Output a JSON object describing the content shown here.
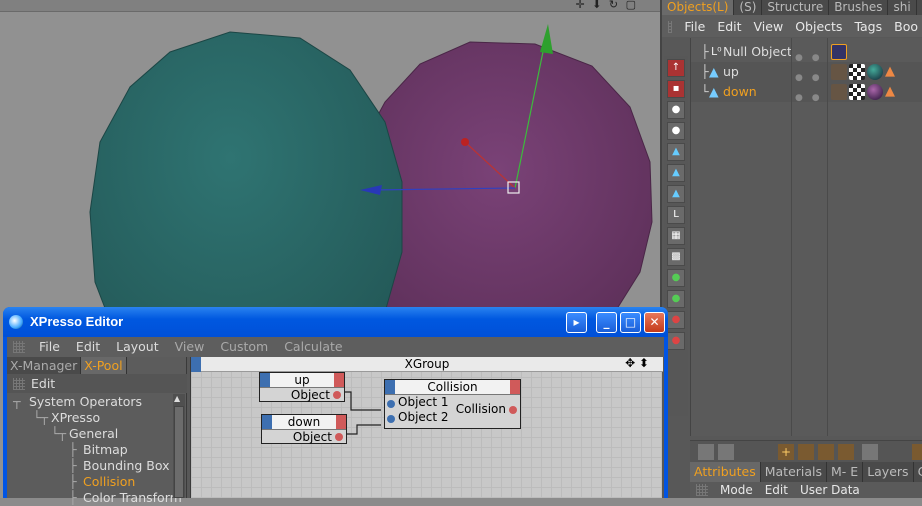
{
  "viewport": {
    "nav_icons": "✛ ⬇ ↻ ▢",
    "sphere_left_color": "#2b6a69",
    "sphere_right_color": "#6f3a6a"
  },
  "object_manager": {
    "tabs": [
      "Objects(L)",
      "(S)",
      "Structure",
      "Brushes",
      "shi"
    ],
    "menu": [
      "File",
      "Edit",
      "View",
      "Objects",
      "Tags",
      "Boo"
    ],
    "objects": [
      {
        "name": "Null Object",
        "icon": "null-object-icon",
        "selected": false
      },
      {
        "name": "up",
        "icon": "cone-icon",
        "selected": false
      },
      {
        "name": "down",
        "icon": "cone-icon",
        "selected": true
      }
    ],
    "attr_tabs": [
      "Attributes",
      "Materials",
      "M- E",
      "Layers",
      "Co"
    ],
    "attr_menu": [
      "Mode",
      "Edit",
      "User Data"
    ]
  },
  "xpresso": {
    "title": "XPresso Editor",
    "menu": [
      "File",
      "Edit",
      "Layout",
      "View",
      "Custom",
      "Calculate"
    ],
    "left_tabs": [
      "X-Manager",
      "X-Pool"
    ],
    "left_edit": "Edit",
    "tree": [
      {
        "label": "System Operators",
        "depth": 0,
        "selected": false
      },
      {
        "label": "XPresso",
        "depth": 1,
        "selected": false
      },
      {
        "label": "General",
        "depth": 2,
        "selected": false
      },
      {
        "label": "Bitmap",
        "depth": 3,
        "selected": false
      },
      {
        "label": "Bounding Box",
        "depth": 3,
        "selected": false
      },
      {
        "label": "Collision",
        "depth": 3,
        "selected": true
      },
      {
        "label": "Color Transform",
        "depth": 3,
        "selected": false
      }
    ],
    "graph_title": "XGroup",
    "nodes": {
      "up": {
        "title": "up",
        "port": "Object"
      },
      "down": {
        "title": "down",
        "port": "Object"
      },
      "collision": {
        "title": "Collision",
        "inputs": [
          "Object 1",
          "Object 2"
        ],
        "output": "Collision"
      }
    }
  },
  "colors": {
    "accent": "#f0a020",
    "xp_title": "#0058e0",
    "port_in": "#3d6fb0",
    "port_out": "#d05a5a"
  }
}
